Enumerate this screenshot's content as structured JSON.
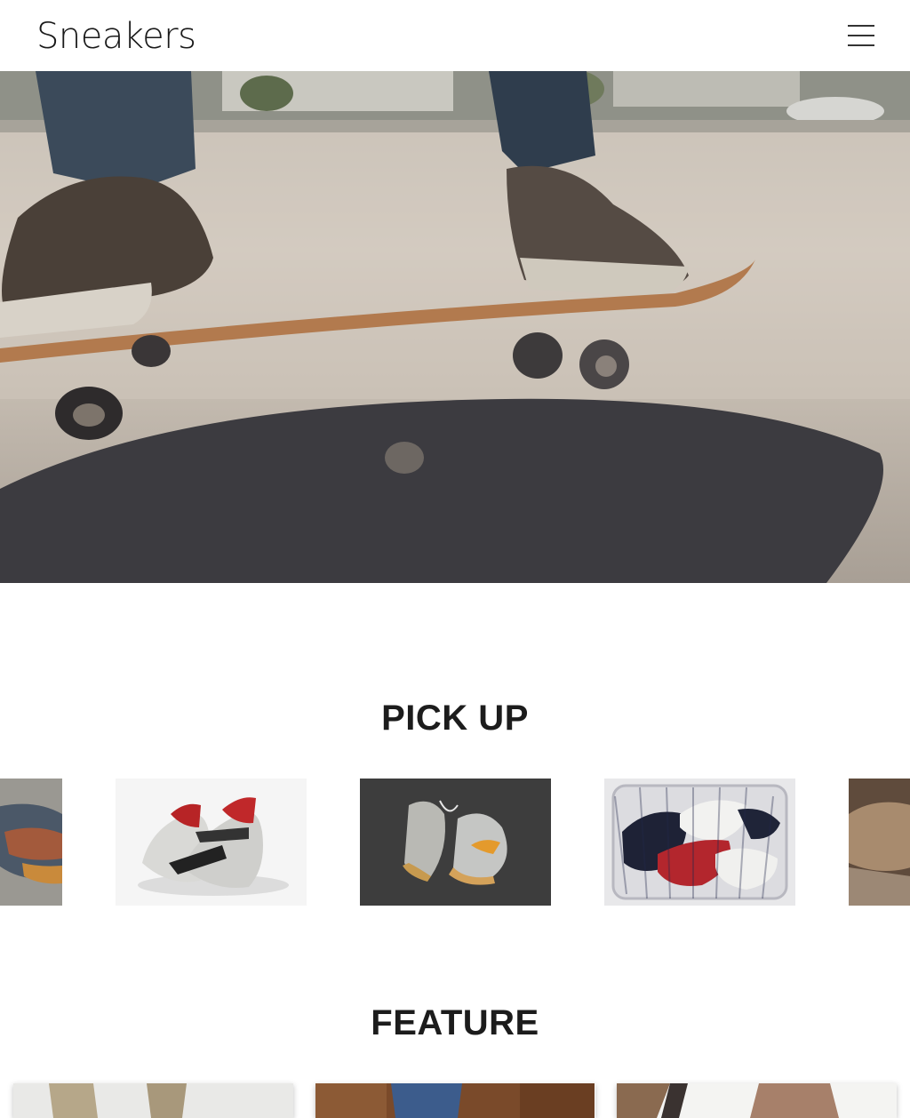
{
  "header": {
    "logo": "Sneakers",
    "menu_icon": "hamburger-menu-icon"
  },
  "hero": {
    "image": "skateboard-sneakers-photo"
  },
  "pickup": {
    "title": "PICK UP",
    "slides": [
      {
        "image": "colorful-knit-sneaker-photo"
      },
      {
        "image": "white-red-running-sneakers-photo"
      },
      {
        "image": "grey-orange-high-tops-photo"
      },
      {
        "image": "converse-basket-photo"
      },
      {
        "image": "brown-sneaker-photo"
      }
    ]
  },
  "feature": {
    "title": "FEATURE",
    "cards": [
      {
        "image": "khaki-pants-photo"
      },
      {
        "image": "denim-rust-photo"
      },
      {
        "image": "white-sneaker-legs-photo"
      }
    ]
  },
  "colors": {
    "text": "#1c1c1c",
    "background": "#ffffff"
  }
}
